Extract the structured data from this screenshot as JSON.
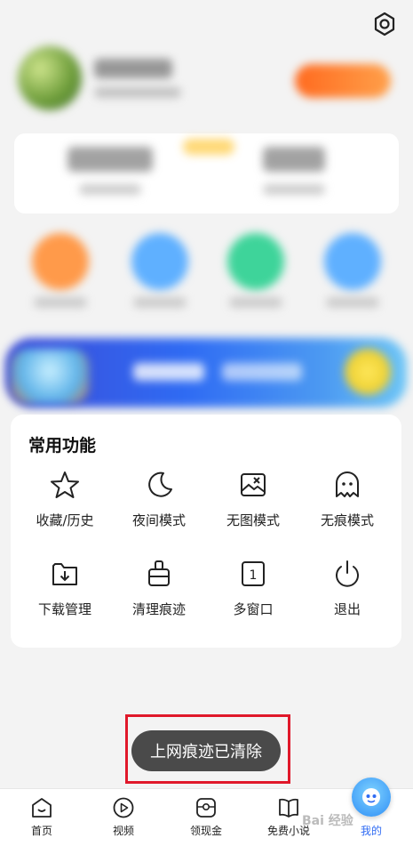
{
  "common_functions": {
    "title": "常用功能",
    "items": [
      {
        "label": "收藏/历史",
        "icon": "star-icon"
      },
      {
        "label": "夜间模式",
        "icon": "moon-icon"
      },
      {
        "label": "无图模式",
        "icon": "no-image-icon"
      },
      {
        "label": "无痕模式",
        "icon": "ghost-icon"
      },
      {
        "label": "下载管理",
        "icon": "download-folder-icon"
      },
      {
        "label": "清理痕迹",
        "icon": "broom-icon"
      },
      {
        "label": "多窗口",
        "icon": "window-count-icon",
        "badge": "1"
      },
      {
        "label": "退出",
        "icon": "power-icon"
      }
    ]
  },
  "toast": {
    "message": "上网痕迹已清除"
  },
  "bottom_nav": {
    "items": [
      {
        "label": "首页",
        "icon": "home-icon"
      },
      {
        "label": "视频",
        "icon": "video-icon"
      },
      {
        "label": "领现金",
        "icon": "cash-icon"
      },
      {
        "label": "免费小说",
        "icon": "book-icon"
      },
      {
        "label": "我的",
        "icon": "profile-icon",
        "active": true
      }
    ]
  },
  "watermark": "Bai 经验",
  "colors": {
    "accent": "#2f6bf3",
    "toast_bg": "#4a4a4a",
    "highlight_border": "#e0182a"
  }
}
